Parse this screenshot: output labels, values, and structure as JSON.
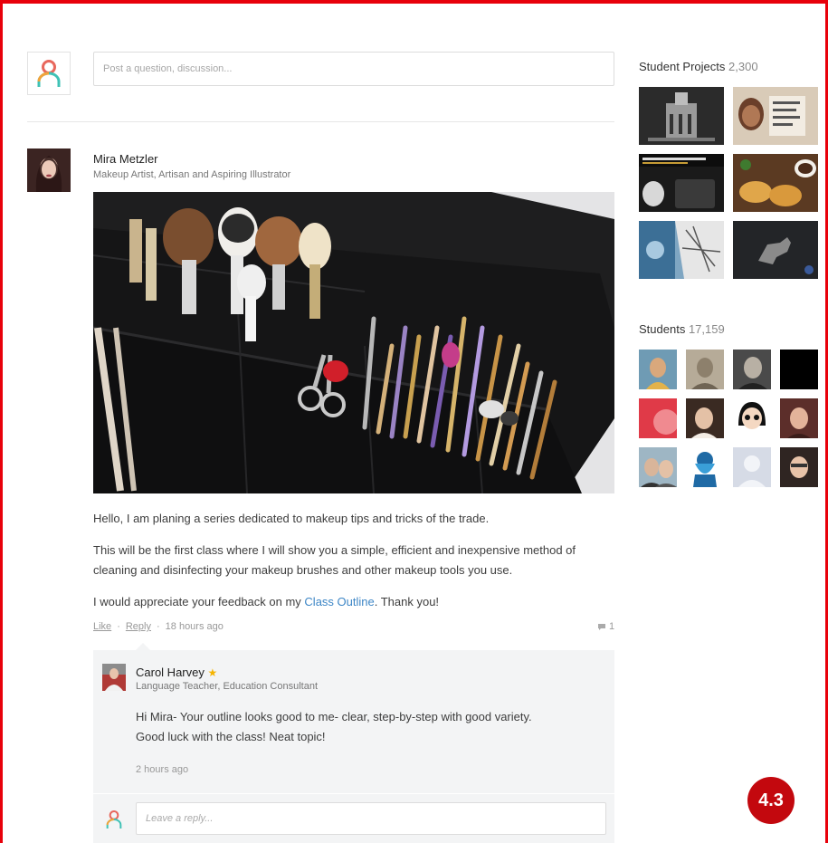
{
  "composer": {
    "placeholder": "Post a question, discussion...",
    "avatar_icon": "user-outline-icon"
  },
  "post": {
    "author_name": "Mira Metzler",
    "author_title": "Makeup Artist, Artisan and Aspiring Illustrator",
    "image_desc": "makeup-brushes-photo",
    "paragraph1": "Hello, I am planing a series dedicated to makeup tips and tricks of the trade.",
    "paragraph2": "This will be the first class where I will show you a simple, efficient and inexpensive method of cleaning and disinfecting your makeup brushes and other makeup tools you use.",
    "paragraph3_before": "I would appreciate your feedback on my ",
    "paragraph3_link": "Class Outline",
    "paragraph3_after": ". Thank you!",
    "like_label": "Like",
    "reply_label": "Reply",
    "time": "18 hours ago",
    "comment_count": "1"
  },
  "reply": {
    "author_name": "Carol Harvey",
    "author_title": "Language Teacher, Education Consultant",
    "line1": "Hi Mira- Your outline looks good to me- clear, step-by-step with good variety.",
    "line2": "Good luck with the class! Neat topic!",
    "time": "2 hours ago"
  },
  "reply_composer": {
    "placeholder": "Leave a reply..."
  },
  "sidebar": {
    "projects_label": "Student Projects",
    "projects_count": "2,300",
    "students_label": "Students",
    "students_count": "17,159"
  },
  "badge": "4.3",
  "colors": {
    "frame": "#e8000b",
    "link": "#3d86c6",
    "badge": "#c3080e",
    "star": "#f5b400"
  }
}
